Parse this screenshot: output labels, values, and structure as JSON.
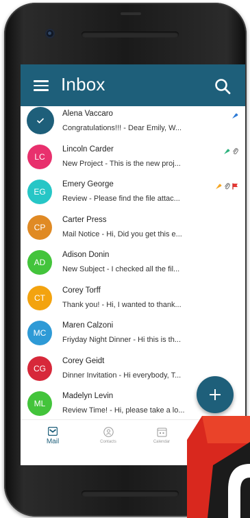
{
  "appbar": {
    "title": "Inbox",
    "menu_icon": "hamburger-menu-icon",
    "search_icon": "search-icon",
    "color": "#1e5f7a"
  },
  "messages": [
    {
      "initials": "",
      "color": "#1e5f7a",
      "sender": "Alena Vaccaro",
      "subject": "Congratulations!!!",
      "snippet": "Dear Emily, W...",
      "selected": true,
      "flags": [
        "blue-tag"
      ]
    },
    {
      "initials": "LC",
      "color": "#e8306d",
      "sender": "Lincoln Carder",
      "subject": "New Project",
      "snippet": "This is the new proj...",
      "selected": false,
      "flags": [
        "green-tag",
        "attachment"
      ]
    },
    {
      "initials": "EG",
      "color": "#26c6c6",
      "sender": "Emery George",
      "subject": "Review",
      "snippet": "Please find the file attac...",
      "selected": false,
      "flags": [
        "orange-tag",
        "attachment",
        "red-flag"
      ]
    },
    {
      "initials": "CP",
      "color": "#e08a24",
      "sender": "Carter Press",
      "subject": "Mail Notice",
      "snippet": "Hi, Did you get this e...",
      "selected": false,
      "flags": []
    },
    {
      "initials": "AD",
      "color": "#43c43b",
      "sender": "Adison Donin",
      "subject": "New Subject",
      "snippet": "I checked all the fil...",
      "selected": false,
      "flags": []
    },
    {
      "initials": "CT",
      "color": "#f3a30f",
      "sender": "Corey Torff",
      "subject": "Thank you!",
      "snippet": "Hi, I wanted to thank...",
      "selected": false,
      "flags": []
    },
    {
      "initials": "MC",
      "color": "#2e9ad6",
      "sender": "Maren Calzoni",
      "subject": "Friyday Night Dinner",
      "snippet": "Hi this is th...",
      "selected": false,
      "flags": []
    },
    {
      "initials": "CG",
      "color": "#d7283a",
      "sender": "Corey Geidt",
      "subject": "Dinner Invitation",
      "snippet": "Hi everybody, T...",
      "selected": false,
      "flags": []
    },
    {
      "initials": "ML",
      "color": "#43c43b",
      "sender": "Madelyn Levin",
      "subject": "Review Time!",
      "snippet": "Hi, please take a lo...",
      "selected": false,
      "flags": []
    }
  ],
  "fab": {
    "icon": "plus-icon"
  },
  "bottom_nav": [
    {
      "label": "Mail",
      "icon": "mail-icon",
      "active": true
    },
    {
      "label": "Contacts",
      "icon": "contacts-icon",
      "active": false
    },
    {
      "label": "Calendar",
      "icon": "calendar-icon",
      "active": false
    }
  ],
  "overlay_logo": {
    "icon": "brand-logo-icon",
    "color": "#d9281e"
  }
}
